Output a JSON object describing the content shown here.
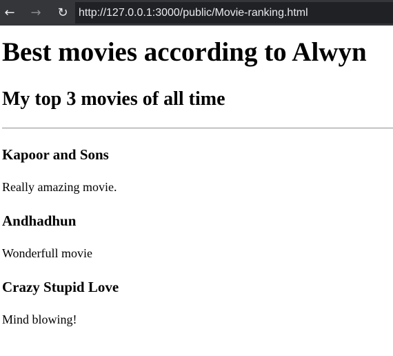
{
  "browser": {
    "url": "http://127.0.0.1:3000/public/Movie-ranking.html",
    "back_glyph": "←",
    "forward_glyph": "→",
    "reload_glyph": "↻"
  },
  "page": {
    "title": "Best movies according to Alwyn",
    "subtitle": "My top 3 movies of all time",
    "movies": [
      {
        "name": "Kapoor and Sons",
        "review": "Really amazing movie."
      },
      {
        "name": "Andhadhun",
        "review": "Wonderfull movie"
      },
      {
        "name": "Crazy Stupid Love",
        "review": "Mind blowing!"
      }
    ]
  }
}
